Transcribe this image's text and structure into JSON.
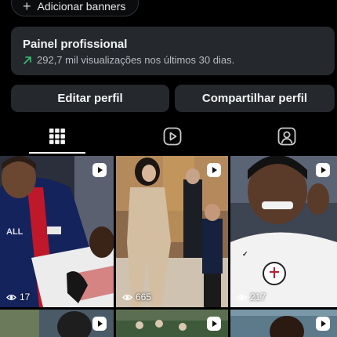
{
  "banner": {
    "label": "Adicionar banners"
  },
  "panel": {
    "title": "Painel profissional",
    "stat": "292,7 mil visualizações nos últimos 30 dias.",
    "accent_color": "#38c172"
  },
  "buttons": {
    "edit": "Editar perfil",
    "share": "Compartilhar perfil"
  },
  "tabs": [
    {
      "icon": "grid-icon",
      "active": true
    },
    {
      "icon": "reels-icon",
      "active": false
    },
    {
      "icon": "tagged-icon",
      "active": false
    }
  ],
  "posts": [
    {
      "type": "reel",
      "views": "17",
      "icon": "play-icon"
    },
    {
      "type": "reel",
      "views": "665",
      "icon": "play-icon"
    },
    {
      "type": "reel",
      "views": "217",
      "icon": "play-icon"
    },
    {
      "type": "reel",
      "views": "",
      "icon": "play-icon"
    },
    {
      "type": "reel",
      "views": "",
      "icon": "play-icon"
    },
    {
      "type": "reel",
      "views": "",
      "icon": "play-icon"
    }
  ]
}
